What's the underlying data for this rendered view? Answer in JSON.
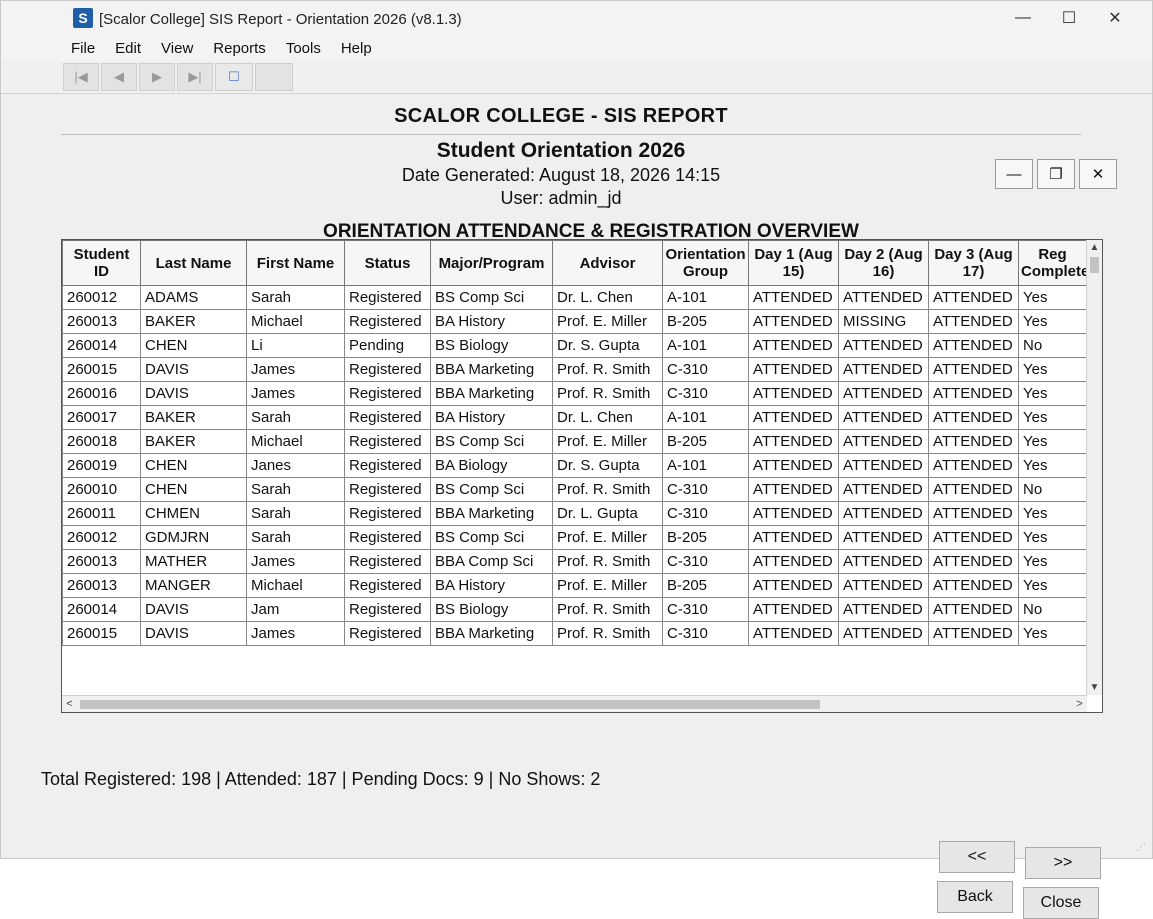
{
  "window": {
    "icon_letter": "S",
    "title": "[Scalor College] SIS Report - Orientation 2026 (v8.1.3)",
    "controls": {
      "minimize": "—",
      "maximize": "☐",
      "close": "✕"
    }
  },
  "menu": [
    "File",
    "Edit",
    "View",
    "Reports",
    "Tools",
    "Help"
  ],
  "toolbar": {
    "first": "|◀",
    "prev": "◀",
    "next": "▶",
    "last": "▶|",
    "page": "☐"
  },
  "report": {
    "college_title": "SCALOR COLLEGE - SIS REPORT",
    "title": "Student Orientation 2026",
    "date_generated": "Date Generated: August 18, 2026 14:15",
    "user": "User: admin_jd",
    "inner_controls": {
      "minimize": "—",
      "restore": "❐",
      "close": "✕"
    },
    "overview_title": "ORIENTATION ATTENDANCE & REGISTRATION OVERVIEW"
  },
  "table": {
    "headers": [
      "Student ID",
      "Last Name",
      "First Name",
      "Status",
      "Major/Program",
      "Advisor",
      "Orientation Group",
      "Day 1 (Aug 15)",
      "Day 2 (Aug 16)",
      "Day 3 (Aug 17)",
      "Reg Complete?"
    ],
    "rows": [
      [
        "260012",
        "ADAMS",
        "Sarah",
        "Registered",
        "BS Comp Sci",
        "Dr. L. Chen",
        "A-101",
        "ATTENDED",
        "ATTENDED",
        "ATTENDED",
        "Yes"
      ],
      [
        "260013",
        "BAKER",
        "Michael",
        "Registered",
        "BA History",
        "Prof. E. Miller",
        "B-205",
        "ATTENDED",
        "MISSING",
        "ATTENDED",
        "Yes"
      ],
      [
        "260014",
        "CHEN",
        "Li",
        "Pending",
        "BS Biology",
        "Dr. S. Gupta",
        "A-101",
        "ATTENDED",
        "ATTENDED",
        "ATTENDED",
        "No"
      ],
      [
        "260015",
        "DAVIS",
        "James",
        "Registered",
        "BBA Marketing",
        "Prof. R. Smith",
        "C-310",
        "ATTENDED",
        "ATTENDED",
        "ATTENDED",
        "Yes"
      ],
      [
        "260016",
        "DAVIS",
        "James",
        "Registered",
        "BBA Marketing",
        "Prof. R. Smith",
        "C-310",
        "ATTENDED",
        "ATTENDED",
        "ATTENDED",
        "Yes"
      ],
      [
        "260017",
        "BAKER",
        "Sarah",
        "Registered",
        "BA History",
        "Dr. L. Chen",
        "A-101",
        "ATTENDED",
        "ATTENDED",
        "ATTENDED",
        "Yes"
      ],
      [
        "260018",
        "BAKER",
        "Michael",
        "Registered",
        "BS Comp Sci",
        "Prof. E. Miller",
        "B-205",
        "ATTENDED",
        "ATTENDED",
        "ATTENDED",
        "Yes"
      ],
      [
        "260019",
        "CHEN",
        "Janes",
        "Registered",
        "BA Biology",
        "Dr. S. Gupta",
        "A-101",
        "ATTENDED",
        "ATTENDED",
        "ATTENDED",
        "Yes"
      ],
      [
        "260010",
        "CHEN",
        "Sarah",
        "Registered",
        "BS Comp Sci",
        "Prof. R. Smith",
        "C-310",
        "ATTENDED",
        "ATTENDED",
        "ATTENDED",
        "No"
      ],
      [
        "260011",
        "CHMEN",
        "Sarah",
        "Registered",
        "BBA Marketing",
        "Dr. L. Gupta",
        "C-310",
        "ATTENDED",
        "ATTENDED",
        "ATTENDED",
        "Yes"
      ],
      [
        "260012",
        "GDMJRN",
        "Sarah",
        "Registered",
        "BS Comp Sci",
        "Prof. E. Miller",
        "B-205",
        "ATTENDED",
        "ATTENDED",
        "ATTENDED",
        "Yes"
      ],
      [
        "260013",
        "MATHER",
        "James",
        "Registered",
        "BBA Comp Sci",
        "Prof. R. Smith",
        "C-310",
        "ATTENDED",
        "ATTENDED",
        "ATTENDED",
        "Yes"
      ],
      [
        "260013",
        "MANGER",
        "Michael",
        "Registered",
        "BA History",
        "Prof. E. Miller",
        "B-205",
        "ATTENDED",
        "ATTENDED",
        "ATTENDED",
        "Yes"
      ],
      [
        "260014",
        "DAVIS",
        "Jam",
        "Registered",
        "BS Biology",
        "Prof. R. Smith",
        "C-310",
        "ATTENDED",
        "ATTENDED",
        "ATTENDED",
        "No"
      ],
      [
        "260015",
        "DAVIS",
        "James",
        "Registered",
        "BBA Marketing",
        "Prof. R. Smith",
        "C-310",
        "ATTENDED",
        "ATTENDED",
        "ATTENDED",
        "Yes"
      ]
    ]
  },
  "scroll": {
    "up": "▲",
    "down": "▼",
    "left": "<",
    "right": ">"
  },
  "summary": "Total Registered: 198 | Attended: 187 | Pending Docs: 9 | No Shows: 2",
  "buttons": {
    "prev": "<<",
    "next": ">>",
    "back": "Back",
    "close": "Close"
  }
}
